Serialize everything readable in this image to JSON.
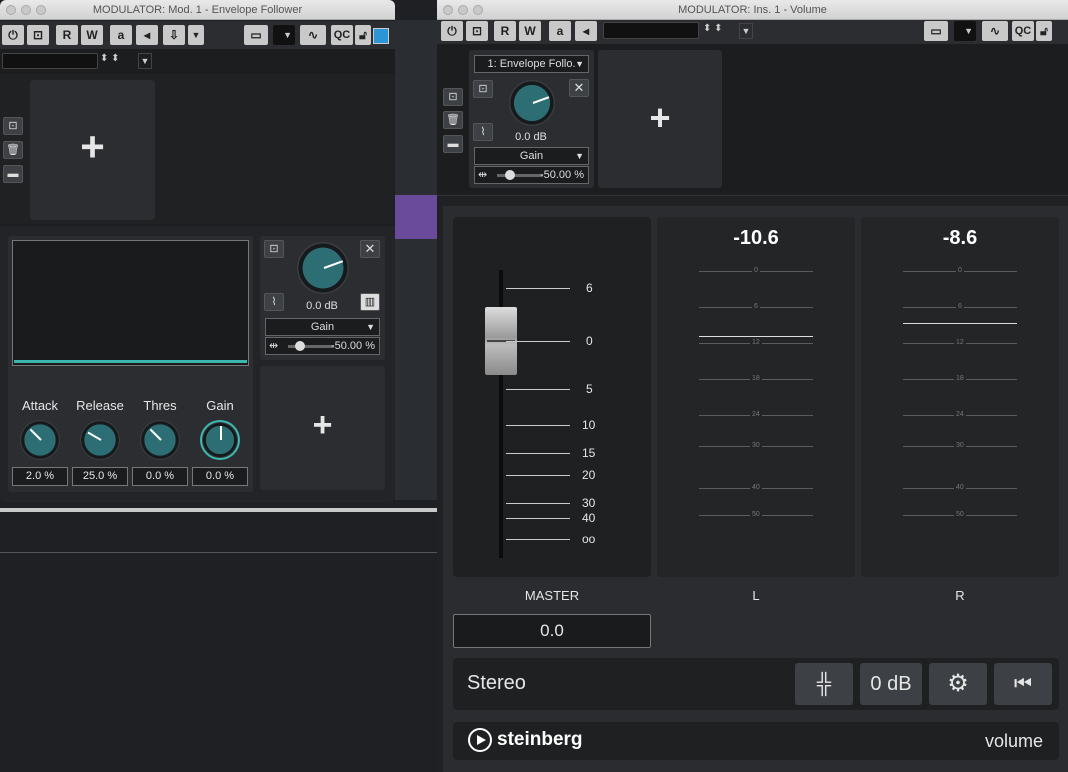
{
  "left_window": {
    "title": "MODULATOR: Mod. 1 - Envelope Follower",
    "toolbar": {
      "r": "R",
      "w": "W",
      "a": "a",
      "qc": "QC"
    },
    "env": {
      "knobs": [
        {
          "label": "Attack",
          "value": "2.0 %"
        },
        {
          "label": "Release",
          "value": "25.0 %"
        },
        {
          "label": "Thres",
          "value": "0.0 %"
        },
        {
          "label": "Gain",
          "value": "0.0 %"
        }
      ]
    },
    "slot": {
      "db": "0.0 dB",
      "param": "Gain",
      "depth": "-50.00 %"
    }
  },
  "right_window": {
    "title": "MODULATOR: Ins. 1 - Volume",
    "toolbar": {
      "r": "R",
      "w": "W",
      "a": "a",
      "qc": "QC"
    },
    "slot": {
      "name": "1: Envelope Follo.",
      "db": "0.0 dB",
      "param": "Gain",
      "depth": "-50.00 %"
    },
    "fader": {
      "scale": [
        "6",
        "0",
        "5",
        "10",
        "15",
        "20",
        "30",
        "40",
        "oo"
      ],
      "label": "MASTER",
      "value": "0.0"
    },
    "meters": [
      {
        "peak": "-10.6",
        "label": "L",
        "scale": [
          "0",
          "6",
          "12",
          "18",
          "24",
          "30",
          "40",
          "50"
        ]
      },
      {
        "peak": "-8.6",
        "label": "R",
        "scale": [
          "0",
          "6",
          "12",
          "18",
          "24",
          "30",
          "40",
          "50"
        ]
      }
    ],
    "bottom": {
      "mode": "Stereo",
      "zero_db": "0 dB"
    },
    "footer": {
      "brand": "steinberg",
      "plugin": "volume"
    }
  }
}
